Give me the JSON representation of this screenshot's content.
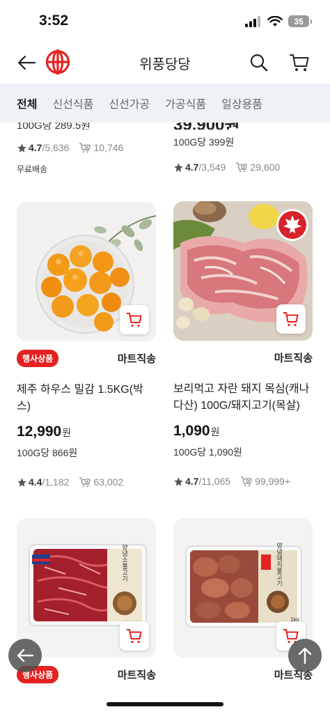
{
  "status": {
    "time": "3:52",
    "battery": "35"
  },
  "header": {
    "title": "위풍당당"
  },
  "tabs": [
    {
      "label": "전체",
      "active": true
    },
    {
      "label": "신선식품"
    },
    {
      "label": "신선가공"
    },
    {
      "label": "가공식품"
    },
    {
      "label": "일상용품"
    }
  ],
  "top_left": {
    "clipped_text": "100G당 289.5원",
    "rating": "4.7",
    "reviews": "/5,636",
    "sold": "10,746",
    "free_shipping": "무료배송"
  },
  "top_right": {
    "clipped_price": "39,900원",
    "per_unit": "100G당 399원",
    "rating": "4.7",
    "reviews": "/3,549",
    "sold": "29,600"
  },
  "products": [
    {
      "badge": "행사상품",
      "seller": "마트직송",
      "name": "제주 하우스 밀감 1.5KG(박스)",
      "price": "12,990",
      "currency": "원",
      "per_unit": "100G당 866원",
      "rating": "4.4",
      "reviews": "/1,182",
      "sold": "63,002"
    },
    {
      "badge": "",
      "seller": "마트직송",
      "name": "보리먹고 자란 돼지 목심(캐나다산) 100G/돼지고기(목살)",
      "price": "1,090",
      "currency": "원",
      "per_unit": "100G당 1,090원",
      "rating": "4.7",
      "reviews": "/11,065",
      "sold": "99,999+"
    },
    {
      "badge": "행사상품",
      "seller": "마트직송",
      "image_label": "양념소불고기"
    },
    {
      "badge": "",
      "seller": "마트직송",
      "image_label": "양념돼지불고기",
      "weight": "1kg"
    }
  ],
  "colors": {
    "brand_red": "#e52222",
    "tab_bg": "#eef1f6",
    "star": "#555555"
  }
}
